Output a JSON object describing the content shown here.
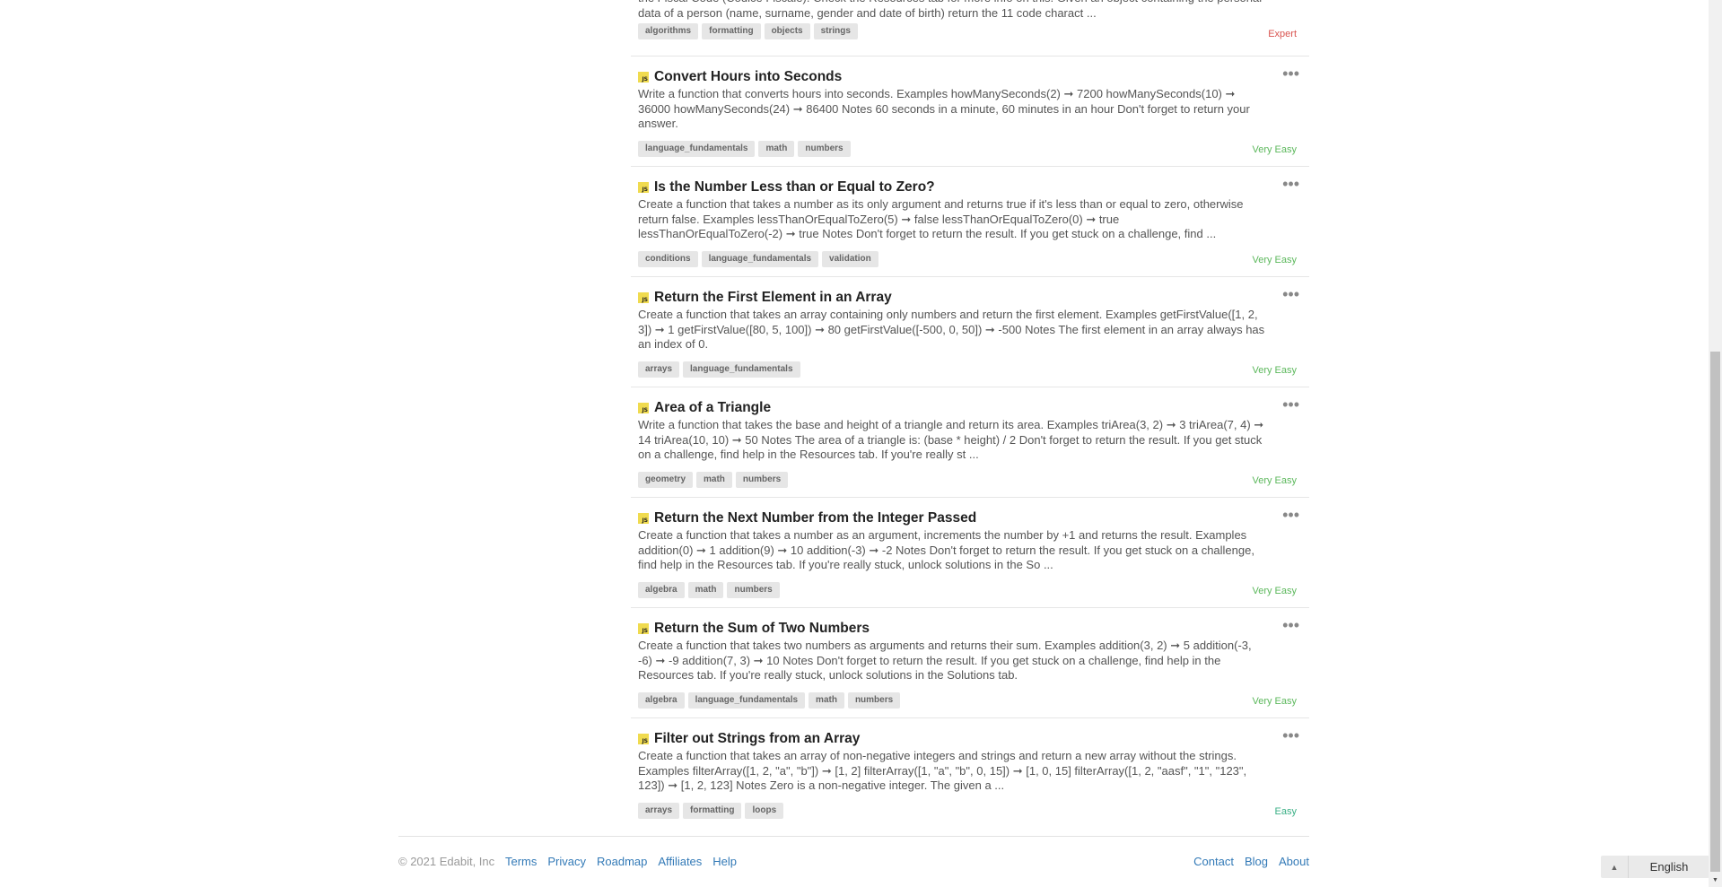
{
  "partial_card": {
    "description": "the Fiscal Code (Codice Fiscale). Check the Resources tab for more info on this. Given an object containing the personal data of a person (name, surname, gender and date of birth) return the 11 code charact ...",
    "tags": [
      "algorithms",
      "formatting",
      "objects",
      "strings"
    ],
    "difficulty": "Expert",
    "difficulty_color": "#d9534f"
  },
  "challenges": [
    {
      "language": "JS",
      "title": "Convert Hours into Seconds",
      "description": "Write a function that converts hours into seconds. Examples howManySeconds(2) ➞ 7200 howManySeconds(10) ➞ 36000 howManySeconds(24) ➞ 86400 Notes 60 seconds in a minute, 60 minutes in an hour Don't forget to return your answer.",
      "tags": [
        "language_fundamentals",
        "math",
        "numbers"
      ],
      "difficulty": "Very Easy",
      "difficulty_color": "#5cb85c"
    },
    {
      "language": "JS",
      "title": "Is the Number Less than or Equal to Zero?",
      "description": "Create a function that takes a number as its only argument and returns true if it's less than or equal to zero, otherwise return false. Examples lessThanOrEqualToZero(5) ➞ false lessThanOrEqualToZero(0) ➞ true lessThanOrEqualToZero(-2) ➞ true Notes Don't forget to return the result. If you get stuck on a challenge, find ...",
      "tags": [
        "conditions",
        "language_fundamentals",
        "validation"
      ],
      "difficulty": "Very Easy",
      "difficulty_color": "#5cb85c"
    },
    {
      "language": "JS",
      "title": "Return the First Element in an Array",
      "description": "Create a function that takes an array containing only numbers and return the first element. Examples getFirstValue([1, 2, 3]) ➞ 1 getFirstValue([80, 5, 100]) ➞ 80 getFirstValue([-500, 0, 50]) ➞ -500 Notes The first element in an array always has an index of 0.",
      "tags": [
        "arrays",
        "language_fundamentals"
      ],
      "difficulty": "Very Easy",
      "difficulty_color": "#5cb85c"
    },
    {
      "language": "JS",
      "title": "Area of a Triangle",
      "description": "Write a function that takes the base and height of a triangle and return its area. Examples triArea(3, 2) ➞ 3 triArea(7, 4) ➞ 14 triArea(10, 10) ➞ 50 Notes The area of a triangle is: (base * height) / 2 Don't forget to return the result. If you get stuck on a challenge, find help in the Resources tab. If you're really st ...",
      "tags": [
        "geometry",
        "math",
        "numbers"
      ],
      "difficulty": "Very Easy",
      "difficulty_color": "#5cb85c"
    },
    {
      "language": "JS",
      "title": "Return the Next Number from the Integer Passed",
      "description": "Create a function that takes a number as an argument, increments the number by +1 and returns the result. Examples addition(0) ➞ 1 addition(9) ➞ 10 addition(-3) ➞ -2 Notes Don't forget to return the result. If you get stuck on a challenge, find help in the Resources tab. If you're really stuck, unlock solutions in the So ...",
      "tags": [
        "algebra",
        "math",
        "numbers"
      ],
      "difficulty": "Very Easy",
      "difficulty_color": "#5cb85c"
    },
    {
      "language": "JS",
      "title": "Return the Sum of Two Numbers",
      "description": "Create a function that takes two numbers as arguments and returns their sum. Examples addition(3, 2) ➞ 5 addition(-3, -6) ➞ -9 addition(7, 3) ➞ 10 Notes Don't forget to return the result. If you get stuck on a challenge, find help in the Resources tab. If you're really stuck, unlock solutions in the Solutions tab.",
      "tags": [
        "algebra",
        "language_fundamentals",
        "math",
        "numbers"
      ],
      "difficulty": "Very Easy",
      "difficulty_color": "#5cb85c"
    },
    {
      "language": "JS",
      "title": "Filter out Strings from an Array",
      "description": "Create a function that takes an array of non-negative integers and strings and return a new array without the strings. Examples filterArray([1, 2, \"a\", \"b\"]) ➞ [1, 2] filterArray([1, \"a\", \"b\", 0, 15]) ➞ [1, 0, 15] filterArray([1, 2, \"aasf\", \"1\", \"123\", 123]) ➞ [1, 2, 123] Notes Zero is a non-negative integer. The given a ...",
      "tags": [
        "arrays",
        "formatting",
        "loops"
      ],
      "difficulty": "Easy",
      "difficulty_color": "#3aaf85"
    }
  ],
  "footer": {
    "copyright": "© 2021 Edabit, Inc",
    "left_links": [
      "Terms",
      "Privacy",
      "Roadmap",
      "Affiliates",
      "Help"
    ],
    "right_links": [
      "Contact",
      "Blog",
      "About"
    ]
  },
  "language_selector": {
    "label": "English",
    "icon": "caret-up-icon"
  },
  "colors": {
    "link": "#337ab7",
    "js_badge": "#f0db4f",
    "tag_bg": "#e6e6e6"
  }
}
